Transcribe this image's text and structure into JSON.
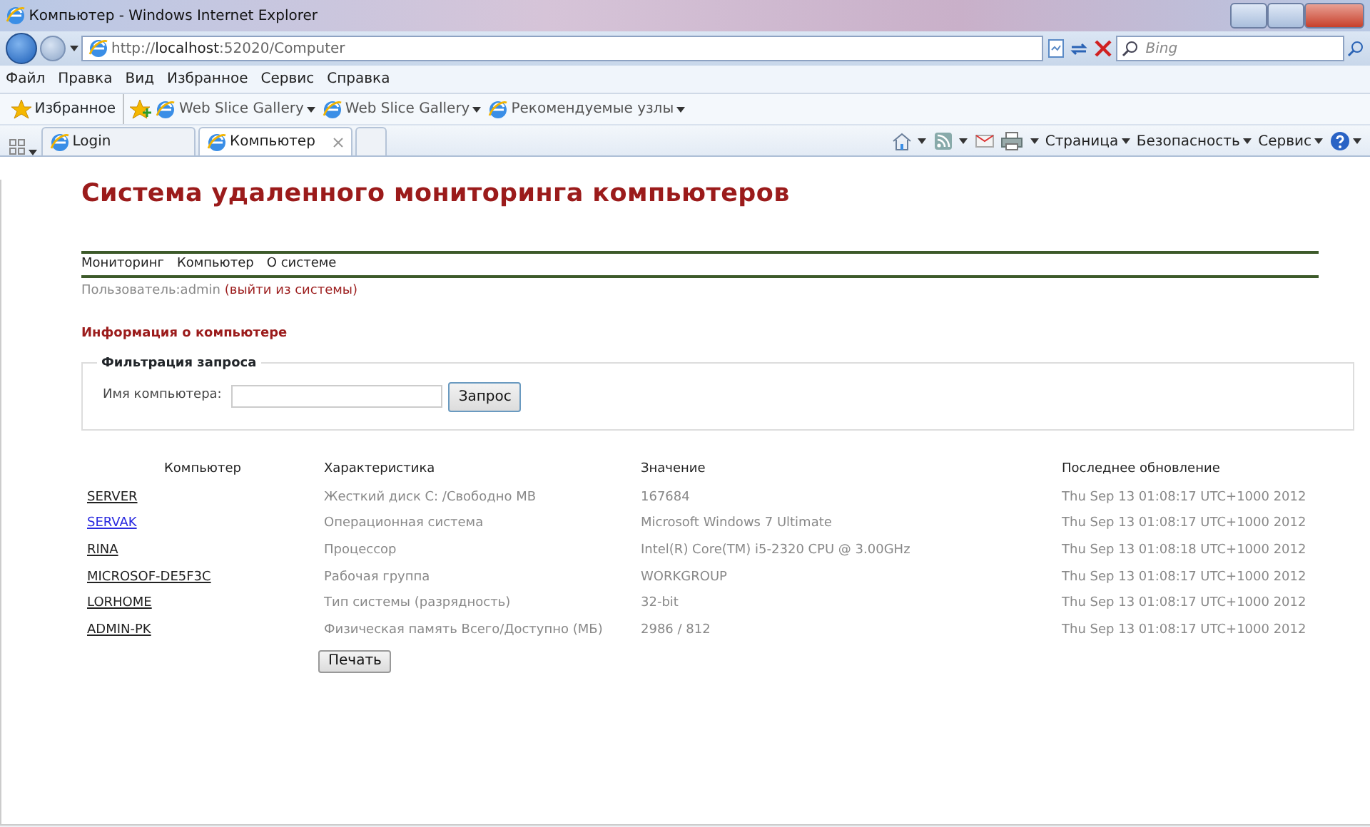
{
  "window": {
    "title": "Компьютер - Windows Internet Explorer"
  },
  "address_bar": {
    "url": "http://**localhost**:52020/Computer"
  },
  "search": {
    "placeholder": "Bing"
  },
  "menu_bar": [
    "Файл",
    "Правка",
    "Вид",
    "Избранное",
    "Сервис",
    "Справка"
  ],
  "favorites_bar": {
    "label": "Избранное",
    "items": [
      "Web Slice Gallery",
      "Web Slice Gallery",
      "Рекомендуемые узлы"
    ]
  },
  "tabs": [
    {
      "label": "Login",
      "selected": false
    },
    {
      "label": "Компьютер",
      "selected": true
    }
  ],
  "command_bar": [
    "Страница",
    "Безопасность",
    "Сервис"
  ],
  "page": {
    "heading": "Система удаленного мониторинга компьютеров",
    "nav": [
      "Мониторинг",
      "Компьютер",
      "О системе"
    ],
    "user": "Пользователь:admin",
    "logout": "(выйти из системы)",
    "section_title": "Информация о компьютере",
    "filter": {
      "legend": "Фильтрация запроса",
      "label": "Имя компьютера:",
      "button": "Запрос"
    },
    "table": {
      "columns": [
        "Компьютер",
        "Характеристика",
        "Значение",
        "Последнее обновление"
      ],
      "rows": [
        {
          "computer": "SERVER",
          "visited": true,
          "characteristic": "Жесткий диск С: /Свободно МВ",
          "value": "167684",
          "updated": "Thu Sep 13 01:08:17 UTC+1000 2012"
        },
        {
          "computer": "SERVAK",
          "visited": false,
          "characteristic": "Операционная система",
          "value": "Microsoft Windows 7 Ultimate",
          "updated": "Thu Sep 13 01:08:17 UTC+1000 2012"
        },
        {
          "computer": "RINA",
          "visited": true,
          "characteristic": "Процессор",
          "value": "Intel(R) Core(TM) i5-2320 CPU @ 3.00GHz",
          "updated": "Thu Sep 13 01:08:18 UTC+1000 2012"
        },
        {
          "computer": "MICROSOF-DE5F3C",
          "visited": true,
          "characteristic": "Рабочая группа",
          "value": "WORKGROUP",
          "updated": "Thu Sep 13 01:08:17 UTC+1000 2012"
        },
        {
          "computer": "LORHOME",
          "visited": true,
          "characteristic": "Тип системы (разрядность)",
          "value": "32-bit",
          "updated": "Thu Sep 13 01:08:17 UTC+1000 2012"
        },
        {
          "computer": "ADMIN-PK",
          "visited": true,
          "characteristic": "Физическая память Всего/Доступно (МБ)",
          "value": "2986 / 812",
          "updated": "Thu Sep 13 01:08:17 UTC+1000 2012"
        }
      ]
    },
    "print_button": "Печать"
  }
}
